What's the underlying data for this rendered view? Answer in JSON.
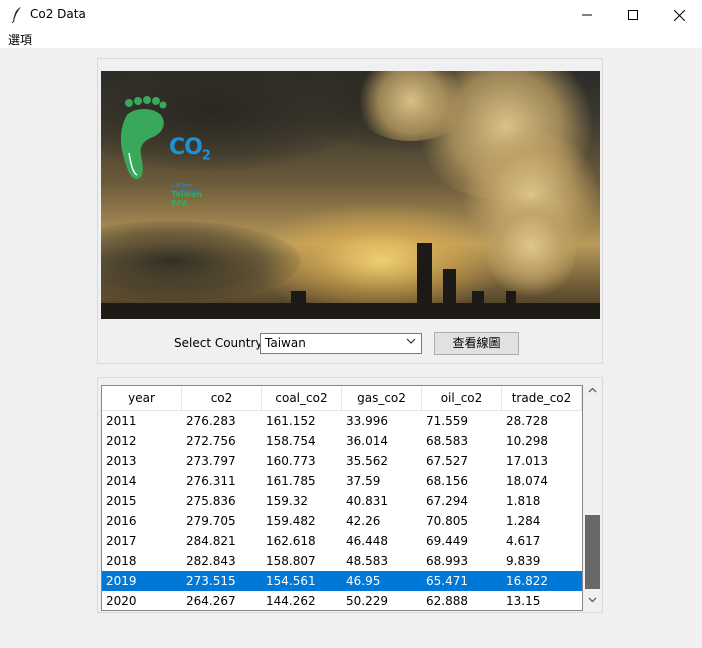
{
  "window": {
    "title": "Co2 Data",
    "minimize_glyph": "—",
    "maximize_glyph": "☐",
    "close_glyph": "✕"
  },
  "menu": {
    "items": [
      "選項"
    ]
  },
  "banner": {
    "logo_text": "CO",
    "logo_sub": "2",
    "logo_line1": "Carbon Footprint",
    "logo_line2": "Taiwan EPA"
  },
  "controls": {
    "select_label": "Select Country:",
    "country_value": "Taiwan",
    "view_button": "查看線圖"
  },
  "table": {
    "columns": [
      "year",
      "co2",
      "coal_co2",
      "gas_co2",
      "oil_co2",
      "trade_co2"
    ],
    "rows": [
      [
        "2011",
        "276.283",
        "161.152",
        "33.996",
        "71.559",
        "28.728"
      ],
      [
        "2012",
        "272.756",
        "158.754",
        "36.014",
        "68.583",
        "10.298"
      ],
      [
        "2013",
        "273.797",
        "160.773",
        "35.562",
        "67.527",
        "17.013"
      ],
      [
        "2014",
        "276.311",
        "161.785",
        "37.59",
        "68.156",
        "18.074"
      ],
      [
        "2015",
        "275.836",
        "159.32",
        "40.831",
        "67.294",
        "1.818"
      ],
      [
        "2016",
        "279.705",
        "159.482",
        "42.26",
        "70.805",
        "1.284"
      ],
      [
        "2017",
        "284.821",
        "162.618",
        "46.448",
        "69.449",
        "4.617"
      ],
      [
        "2018",
        "282.843",
        "158.807",
        "48.583",
        "68.993",
        "9.839"
      ],
      [
        "2019",
        "273.515",
        "154.561",
        "46.95",
        "65.471",
        "16.822"
      ],
      [
        "2020",
        "264.267",
        "144.262",
        "50.229",
        "62.888",
        "13.15"
      ]
    ],
    "selected_row": 8
  },
  "colors": {
    "selection": "#0078d7",
    "logo_blue": "#1f8fd6",
    "logo_green": "#3aa85a"
  }
}
